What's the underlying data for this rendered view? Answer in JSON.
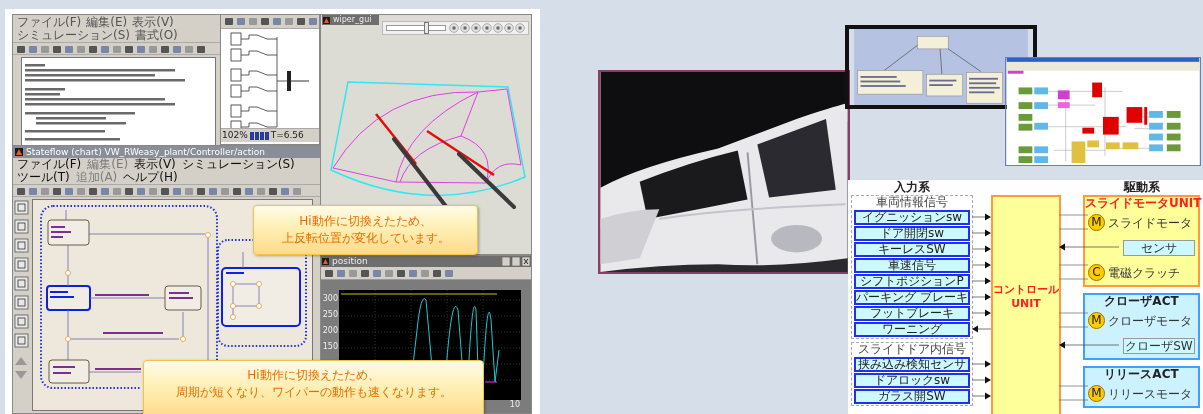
{
  "editor_window": {
    "menu": [
      "ファイル(F)",
      "編集(E)",
      "表示(V)",
      "シミュレーション(S)",
      "書式(O)"
    ]
  },
  "model_window": {
    "zoom": "102%",
    "time": "T=6.56"
  },
  "stateflow_window": {
    "title": "Stateflow (chart) VW_RWeasy_plant/Controller/action",
    "menu": [
      {
        "label": "ファイル(F)",
        "disabled": false
      },
      {
        "label": "編集(E)",
        "disabled": true
      },
      {
        "label": "表示(V)",
        "disabled": false
      },
      {
        "label": "シミュレーション(S)",
        "disabled": false
      },
      {
        "label": "ツール(T)",
        "disabled": false
      },
      {
        "label": "追加(A)",
        "disabled": true
      },
      {
        "label": "ヘルプ(H)",
        "disabled": false
      }
    ]
  },
  "wiper_window": {
    "title": "wiper_gui",
    "player": {
      "level": 0.68
    }
  },
  "position_window": {
    "title": "position",
    "y_ticks": [
      "300",
      "250",
      "200",
      "150"
    ],
    "x_tick": "10"
  },
  "callouts": [
    {
      "lines": [
        "Hi動作に切換えたため、",
        "上反転位置が変化しています。"
      ]
    },
    {
      "lines": [
        "Hi動作に切換えたため、",
        "周期が短くなり、ワイパーの動作も速くなります。"
      ]
    }
  ],
  "diagram": {
    "input_title": "入力系",
    "output_title": "駆動系",
    "controller": [
      "コントロール",
      "UNIT"
    ],
    "input_groups": [
      {
        "label": "車両情報信号",
        "items": [
          {
            "label": "イグニッションsw",
            "kind": "input"
          },
          {
            "label": "ドア開閉sw",
            "kind": "input"
          },
          {
            "label": "キーレスSW",
            "kind": "input"
          },
          {
            "label": "車速信号",
            "kind": "input"
          },
          {
            "label": "シフトポジションP",
            "kind": "input"
          },
          {
            "label": "パーキング ブレーキ",
            "kind": "input"
          },
          {
            "label": "フットブレーキ",
            "kind": "input"
          },
          {
            "label": "ワーニング",
            "kind": "output"
          }
        ]
      },
      {
        "label": "スライドドア内信号",
        "items": [
          {
            "label": "挟み込み検知センサ",
            "kind": "input"
          },
          {
            "label": "ドアロックsw",
            "kind": "input"
          },
          {
            "label": "ガラス開SW",
            "kind": "input"
          }
        ]
      }
    ],
    "output_groups": [
      {
        "title": "スライドモータUNIT",
        "kind": "unit",
        "parts": [
          {
            "kind": "motor",
            "symbol": "M",
            "label": "スライドモータ"
          },
          {
            "kind": "sensor",
            "label": "センサ"
          },
          {
            "kind": "motor",
            "symbol": "C",
            "label": "電磁クラッチ"
          }
        ]
      },
      {
        "title": "クローザACT",
        "kind": "actuator",
        "parts": [
          {
            "kind": "motor",
            "symbol": "M",
            "label": "クローザモータ"
          },
          {
            "kind": "sensor",
            "label": "クローザSW"
          }
        ]
      },
      {
        "title": "リリースACT",
        "kind": "actuator",
        "parts": [
          {
            "kind": "motor",
            "symbol": "M",
            "label": "リリースモータ"
          }
        ]
      }
    ]
  }
}
